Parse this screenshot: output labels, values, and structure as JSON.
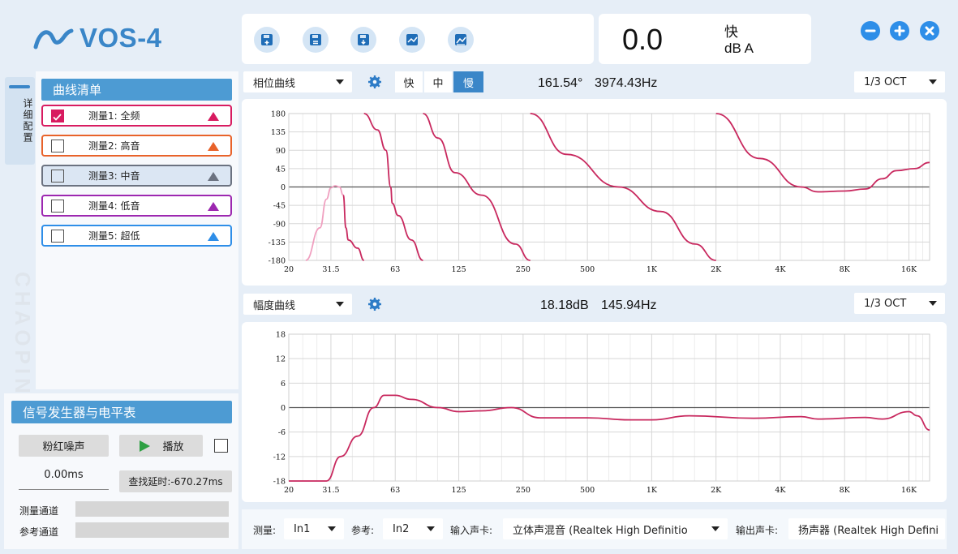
{
  "app": {
    "logo_text": "VOS-4"
  },
  "toolbar": {
    "icons": [
      "save-add-icon",
      "save-list-icon",
      "save-down-icon",
      "chart-line-icon",
      "chart-area-icon"
    ]
  },
  "meter": {
    "value": "0.0",
    "speed": "快",
    "unit": "dB A"
  },
  "window": {
    "icons": [
      "minimize-icon",
      "maximize-icon",
      "close-icon"
    ]
  },
  "side_tab": {
    "label": "详细配置"
  },
  "watermark": "CHAOPIN.",
  "curve_list": {
    "title": "曲线清单",
    "items": [
      {
        "label": "测量1: 全频",
        "checked": true,
        "color": "#d81b60"
      },
      {
        "label": "测量2: 高音",
        "checked": false,
        "color": "#e8622a"
      },
      {
        "label": "测量3: 中音",
        "checked": false,
        "color": "#6b7280"
      },
      {
        "label": "测量4: 低音",
        "checked": false,
        "color": "#9c27b0"
      },
      {
        "label": "测量5: 超低",
        "checked": false,
        "color": "#2e8ee8"
      }
    ]
  },
  "generator": {
    "title": "信号发生器与电平表",
    "signal_button": "粉红噪声",
    "play_button": "播放",
    "delay_value": "0.00ms",
    "find_delay_button": "查找延时:-670.27ms",
    "measure_channel_label": "测量通道",
    "reference_channel_label": "参考通道"
  },
  "phase_panel": {
    "curve_select": "相位曲线",
    "speed_options": [
      "快",
      "中",
      "慢"
    ],
    "speed_selected": "慢",
    "readout_value": "161.54°",
    "readout_freq": "3974.43Hz",
    "oct_select": "1/3 OCT"
  },
  "magnitude_panel": {
    "curve_select": "幅度曲线",
    "readout_value": "18.18dB",
    "readout_freq": "145.94Hz",
    "oct_select": "1/3 OCT"
  },
  "bottom_bar": {
    "measure_label": "测量:",
    "measure_value": "In1",
    "ref_label": "参考:",
    "ref_value": "In2",
    "input_card_label": "输入声卡:",
    "input_card_value": "立体声混音 (Realtek High Definitio",
    "output_card_label": "输出声卡:",
    "output_card_value": "扬声器 (Realtek High Defini"
  },
  "chart_data": [
    {
      "type": "line",
      "name": "phase",
      "x_ticks": [
        "20",
        "31.5",
        "63",
        "125",
        "250",
        "500",
        "1K",
        "2K",
        "4K",
        "8K",
        "16K"
      ],
      "x_tick_values": [
        20,
        31.5,
        63,
        125,
        250,
        500,
        1000,
        2000,
        4000,
        8000,
        16000
      ],
      "y_ticks": [
        "180",
        "135",
        "90",
        "45",
        "0",
        "-45",
        "-90",
        "-135",
        "-180"
      ],
      "ylim": [
        -180,
        180
      ],
      "xlim": [
        20,
        20000
      ],
      "x_scale": "log",
      "grid": true,
      "series": [
        {
          "color": "#f0a0c0",
          "points": [
            [
              24,
              -180
            ],
            [
              28,
              -100
            ],
            [
              30,
              -30
            ],
            [
              31.5,
              -2
            ],
            [
              33,
              3
            ],
            [
              34.5,
              0
            ],
            [
              36,
              -20
            ]
          ]
        },
        {
          "color": "#c8285e",
          "points": [
            [
              36,
              -20
            ],
            [
              37,
              -100
            ],
            [
              38,
              -130
            ],
            [
              42,
              -150
            ],
            [
              45,
              -180
            ]
          ]
        },
        {
          "color": "#c8285e",
          "points": [
            [
              45,
              180
            ],
            [
              52,
              140
            ],
            [
              57,
              90
            ],
            [
              60,
              0
            ],
            [
              61,
              -40
            ],
            [
              65,
              -70
            ],
            [
              75,
              -130
            ],
            [
              85,
              -180
            ]
          ]
        },
        {
          "color": "#c8285e",
          "points": [
            [
              85,
              180
            ],
            [
              100,
              120
            ],
            [
              120,
              35
            ],
            [
              160,
              -20
            ],
            [
              230,
              -140
            ],
            [
              270,
              -180
            ]
          ]
        },
        {
          "color": "#c8285e",
          "points": [
            [
              270,
              180
            ],
            [
              400,
              80
            ],
            [
              700,
              0
            ],
            [
              1100,
              -60
            ],
            [
              1600,
              -140
            ],
            [
              2000,
              -180
            ]
          ]
        },
        {
          "color": "#c8285e",
          "points": [
            [
              2000,
              180
            ],
            [
              3200,
              70
            ],
            [
              5000,
              0
            ],
            [
              6000,
              -12
            ],
            [
              8000,
              -10
            ],
            [
              10000,
              -5
            ],
            [
              12000,
              20
            ],
            [
              14000,
              40
            ],
            [
              17000,
              45
            ],
            [
              20000,
              60
            ]
          ]
        }
      ]
    },
    {
      "type": "line",
      "name": "magnitude",
      "x_ticks": [
        "20",
        "31.5",
        "63",
        "125",
        "250",
        "500",
        "1K",
        "2K",
        "4K",
        "8K",
        "16K"
      ],
      "x_tick_values": [
        20,
        31.5,
        63,
        125,
        250,
        500,
        1000,
        2000,
        4000,
        8000,
        16000
      ],
      "y_ticks": [
        "18",
        "12",
        "6",
        "0",
        "-6",
        "-12",
        "-18"
      ],
      "ylim": [
        -18,
        18
      ],
      "xlim": [
        20,
        20000
      ],
      "x_scale": "log",
      "grid": true,
      "series": [
        {
          "color": "#c8285e",
          "points": [
            [
              20,
              -18
            ],
            [
              30,
              -18
            ],
            [
              35,
              -12
            ],
            [
              42,
              -7
            ],
            [
              50,
              0
            ],
            [
              56,
              3
            ],
            [
              63,
              3
            ],
            [
              75,
              2
            ],
            [
              100,
              0
            ],
            [
              125,
              -1
            ],
            [
              160,
              -0.8
            ],
            [
              220,
              0
            ],
            [
              300,
              -2.5
            ],
            [
              500,
              -2.5
            ],
            [
              800,
              -3
            ],
            [
              1000,
              -3
            ],
            [
              1500,
              -2
            ],
            [
              3000,
              -2.6
            ],
            [
              5000,
              -2.2
            ],
            [
              6000,
              -2.8
            ],
            [
              10000,
              -2.4
            ],
            [
              12000,
              -2.8
            ],
            [
              16000,
              -1
            ],
            [
              17500,
              -2
            ],
            [
              20000,
              -5.5
            ]
          ]
        }
      ]
    }
  ]
}
